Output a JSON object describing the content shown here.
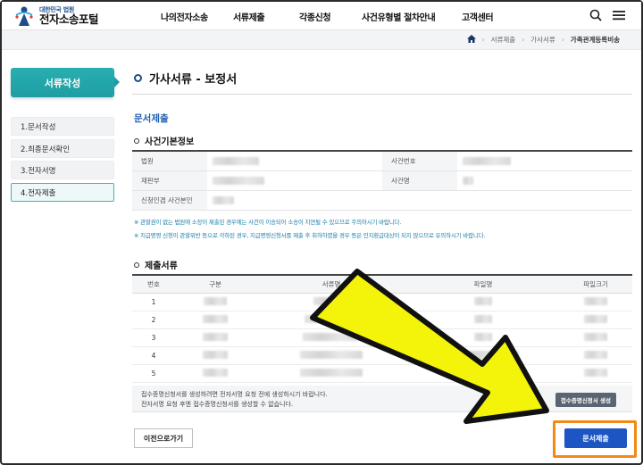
{
  "header": {
    "logo_sub": "대한민국 법원",
    "logo_main": "전자소송포털",
    "nav": [
      "나의전자소송",
      "서류제출",
      "각종신청",
      "사건유형별 절차안내",
      "고객센터"
    ]
  },
  "breadcrumb": [
    "서류제출",
    "가사서류",
    "가족관계등록비송"
  ],
  "sidebar": {
    "title": "서류작성",
    "steps": [
      "1.문서작성",
      "2.최종문서확인",
      "3.전자서명",
      "4.전자제출"
    ]
  },
  "main": {
    "title": "가사서류 - 보정서",
    "section": "문서제출",
    "basic_info_heading": "사건기본정보",
    "info_labels": {
      "court": "법원",
      "case_no": "사건번호",
      "division": "재판부",
      "case_name": "사건명",
      "party": "신청인겸 사건본인"
    },
    "notes": [
      "※ 관할권이 없는 법원에 소장이 제출된 경우에는 사건이 이송되어 소송이 지연될 수 있으므로 주의하시기 바랍니다.",
      "※ 지급명령 신청이 관할위반 등으로 각하된 경우, 지급명령신청서를 제출 후 취하하였을 경우 등은 인지환급대상이 되지 않으므로 유의하시기 바랍니다."
    ],
    "docs_heading": "제출서류",
    "docs_columns": [
      "번호",
      "구분",
      "서류명",
      "파일명",
      "파일크기"
    ],
    "docs_rows": [
      "1",
      "2",
      "3",
      "4",
      "5"
    ],
    "footer_lines": [
      "접수증명신청서를 생성하려면 전자서명 요청 전에 생성하시기 바랍니다.",
      "전자서명 요청 후엔 접수증명신청서를 생성할 수 없습니다."
    ],
    "gen_button": "접수증명신청서 생성",
    "prev_button": "이전으로가기",
    "submit_button": "문서제출"
  },
  "colors": {
    "accent_teal": "#1e9ea3",
    "submit_blue": "#1d56c2",
    "highlight_orange": "#f28a16",
    "arrow_yellow": "#f4f40a"
  }
}
